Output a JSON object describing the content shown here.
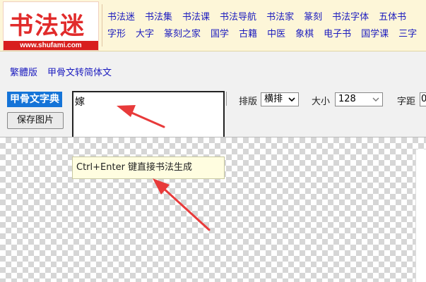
{
  "header": {
    "logo_text": "书法迷",
    "logo_url": "www.shufami.com",
    "nav_row1": [
      "书法迷",
      "书法集",
      "书法课",
      "书法导航",
      "书法家",
      "篆刻",
      "书法字体",
      "五体书"
    ],
    "nav_row2": [
      "字形",
      "大字",
      "篆刻之家",
      "国学",
      "古籍",
      "中医",
      "象棋",
      "电子书",
      "国学课",
      "三字"
    ]
  },
  "subnav": {
    "items": [
      "繁體版",
      "甲骨文转简体文"
    ]
  },
  "tool": {
    "badge": "甲骨文字典",
    "input_value": "嫁",
    "layout_label": "排版",
    "layout_value": "横排",
    "size_label": "大小",
    "size_value": "128",
    "spacing_label": "字距",
    "spacing_value": "0",
    "save_label": "保存图片",
    "tooltip": "Ctrl+Enter 键直接书法生成"
  },
  "colors": {
    "brand_red": "#e12b2b",
    "badge_blue": "#1574d8",
    "link_blue": "#1b1bbf",
    "header_bg": "#fdf6d8",
    "annotation_red": "#e83a3a"
  }
}
